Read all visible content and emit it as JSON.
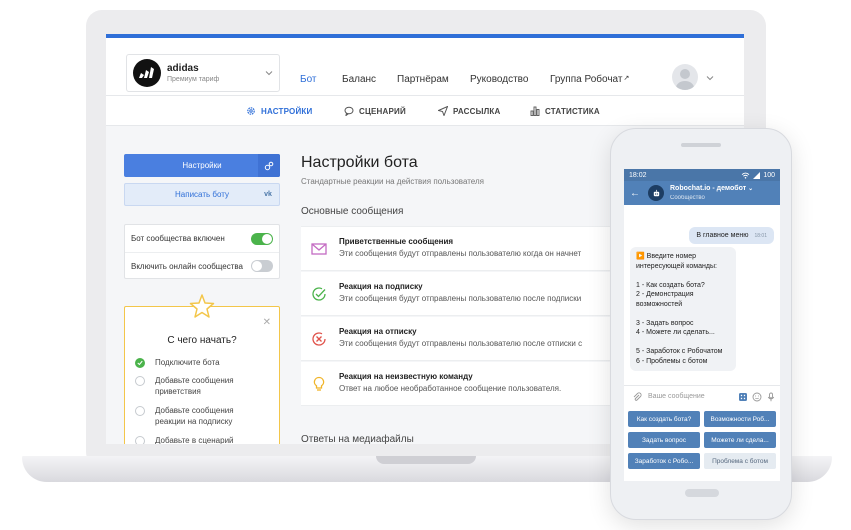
{
  "brand": {
    "name": "adidas",
    "plan": "Премиум тариф"
  },
  "nav": {
    "items": [
      "Бот",
      "Баланс",
      "Партнёрам",
      "Руководство",
      "Группа Робочат"
    ],
    "active_index": 0,
    "external_mark": "↗"
  },
  "subnav": {
    "items": [
      "НАСТРОЙКИ",
      "СЦЕНАРИЙ",
      "РАССЫЛКА",
      "СТАТИСТИКА"
    ],
    "active_index": 0
  },
  "sidebar": {
    "settings_button": "Настройки",
    "write_bot_button": "Написать боту",
    "vk_label": "vk",
    "toggles": [
      {
        "label": "Бот сообщества включен",
        "on": true
      },
      {
        "label": "Включить онлайн сообщества",
        "on": false
      }
    ],
    "start": {
      "title": "С чего начать?",
      "steps": [
        {
          "label": "Подключите бота",
          "done": true
        },
        {
          "label": "Добавьте сообщения приветствия",
          "done": false
        },
        {
          "label": "Добавьте сообщения реакции на подписку",
          "done": false
        },
        {
          "label": "Добавьте в сценарий",
          "done": false
        }
      ]
    }
  },
  "main": {
    "title": "Настройки бота",
    "subtitle": "Стандартные реакции на действия пользователя",
    "section_basic": "Основные сообщения",
    "section_media": "Ответы на медиафайлы",
    "messages": [
      {
        "title": "Приветственные сообщения",
        "desc": "Эти сообщения будут отправлены пользователю когда он начнет",
        "icon": "mail-icon",
        "color": "#c46bc2"
      },
      {
        "title": "Реакция на подписку",
        "desc": "Эти сообщения будут отправлены пользователю после подписки",
        "icon": "check-circle-icon",
        "color": "#4bb34b"
      },
      {
        "title": "Реакция на отписку",
        "desc": "Эти сообщения будут отправлены пользователю после отписки с",
        "icon": "x-circle-icon",
        "color": "#e0524a"
      },
      {
        "title": "Реакция на неизвестную команду",
        "desc": "Ответ на любое необработанное сообщение пользователя.",
        "icon": "bulb-icon",
        "color": "#f0b429"
      }
    ]
  },
  "phone": {
    "time": "18:02",
    "battery": "100",
    "chat_name": "Robochat.io - демобот",
    "chat_status": "Сообщество",
    "out_message": "В главное меню",
    "out_time": "18:01",
    "in_message": "▶️ Введите номер интересующей команды:\n\n1 - Как создать бота?\n2 - Демонстрация возможностей\n\n3 - Задать вопрос\n4 - Можете ли сделать...\n\n5 - Заработок с Робочатом\n6 - Проблемы с ботом",
    "input_placeholder": "Ваше сообщение",
    "keyboard": [
      "Как создать бота?",
      "Возможности Роб...",
      "Задать вопрос",
      "Можете ли сдела...",
      "Заработок с Робо...",
      "Проблема с ботом"
    ]
  },
  "colors": {
    "accent": "#2f6fd8",
    "vk": "#5181b8",
    "success": "#4bb34b",
    "star": "#f3c64a"
  }
}
